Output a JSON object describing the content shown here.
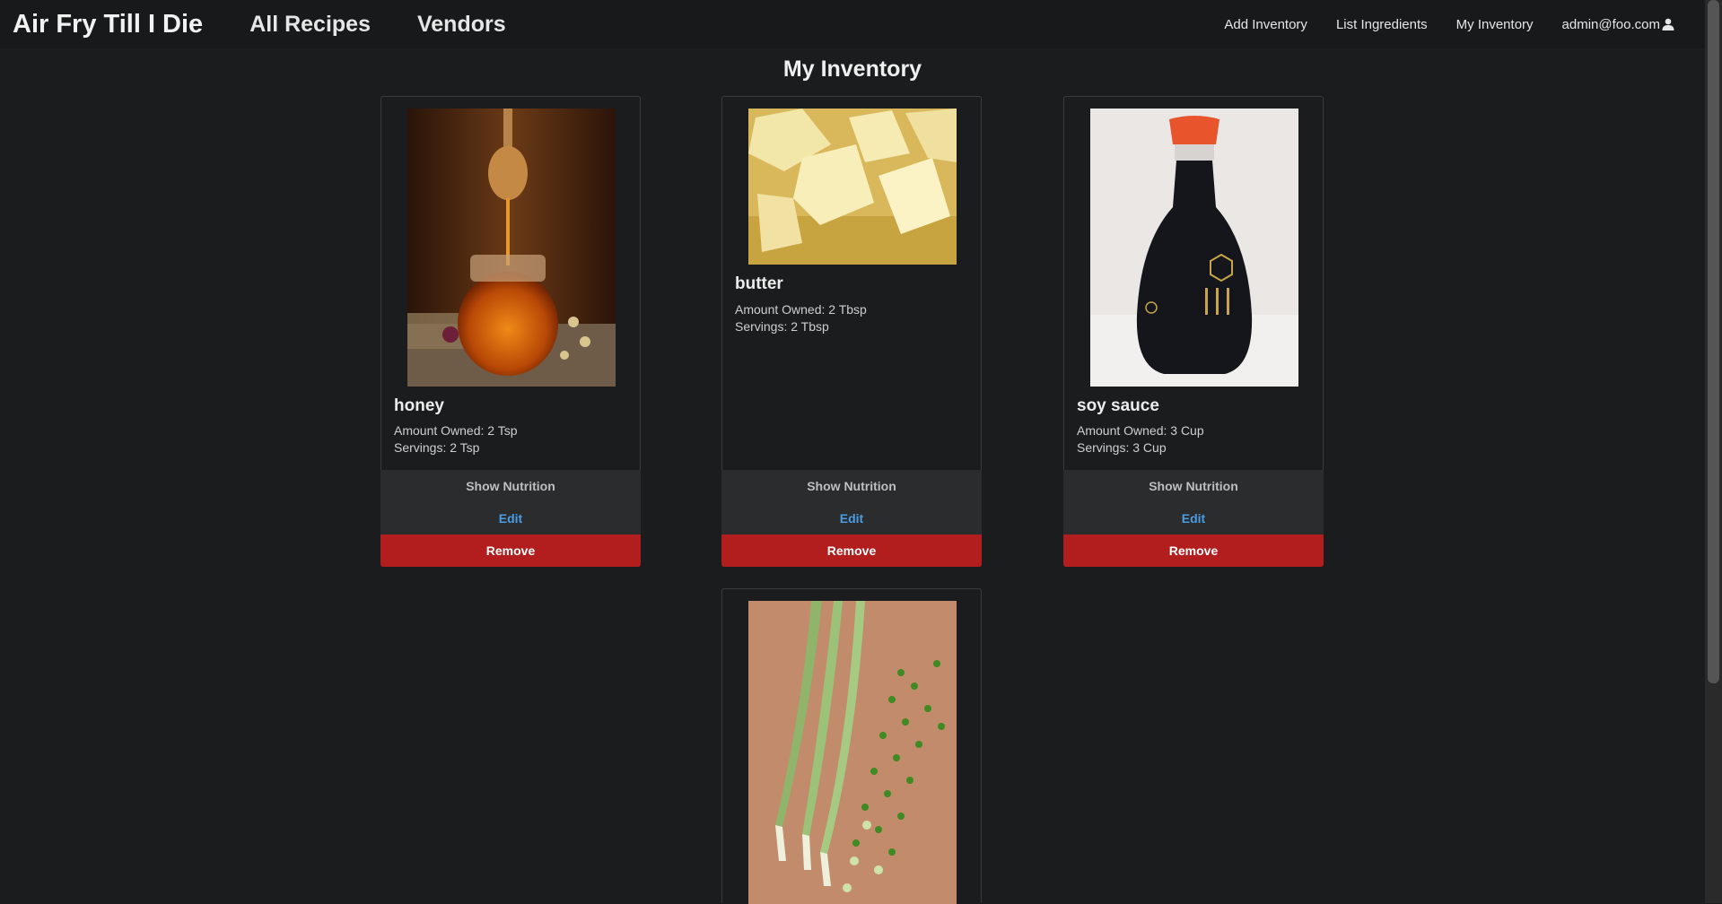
{
  "nav": {
    "brand": "Air Fry Till I Die",
    "main_links": [
      "All Recipes",
      "Vendors"
    ],
    "right_links": [
      "Add Inventory",
      "List Ingredients",
      "My Inventory"
    ],
    "user": "admin@foo.com",
    "user_icon": "user-icon"
  },
  "page": {
    "title": "My Inventory"
  },
  "cards": [
    {
      "name": "honey",
      "amount_owned": "Amount Owned: 2 Tsp",
      "servings": "Servings: 2 Tsp",
      "image": "honey-jar-photo",
      "show_nutrition": "Show Nutrition",
      "edit": "Edit",
      "remove": "Remove"
    },
    {
      "name": "butter",
      "amount_owned": "Amount Owned: 2 Tbsp",
      "servings": "Servings: 2 Tbsp",
      "image": "butter-cubes-photo",
      "show_nutrition": "Show Nutrition",
      "edit": "Edit",
      "remove": "Remove"
    },
    {
      "name": "soy sauce",
      "amount_owned": "Amount Owned: 3 Cup",
      "servings": "Servings: 3 Cup",
      "image": "soy-sauce-bottle-photo",
      "show_nutrition": "Show Nutrition",
      "edit": "Edit",
      "remove": "Remove"
    },
    {
      "image": "green-onions-photo"
    }
  ],
  "colors": {
    "background": "#1b1c1d",
    "remove_button": "#b21e1e",
    "edit_link": "#4a9de3",
    "button_panel": "#2a2c2e"
  }
}
